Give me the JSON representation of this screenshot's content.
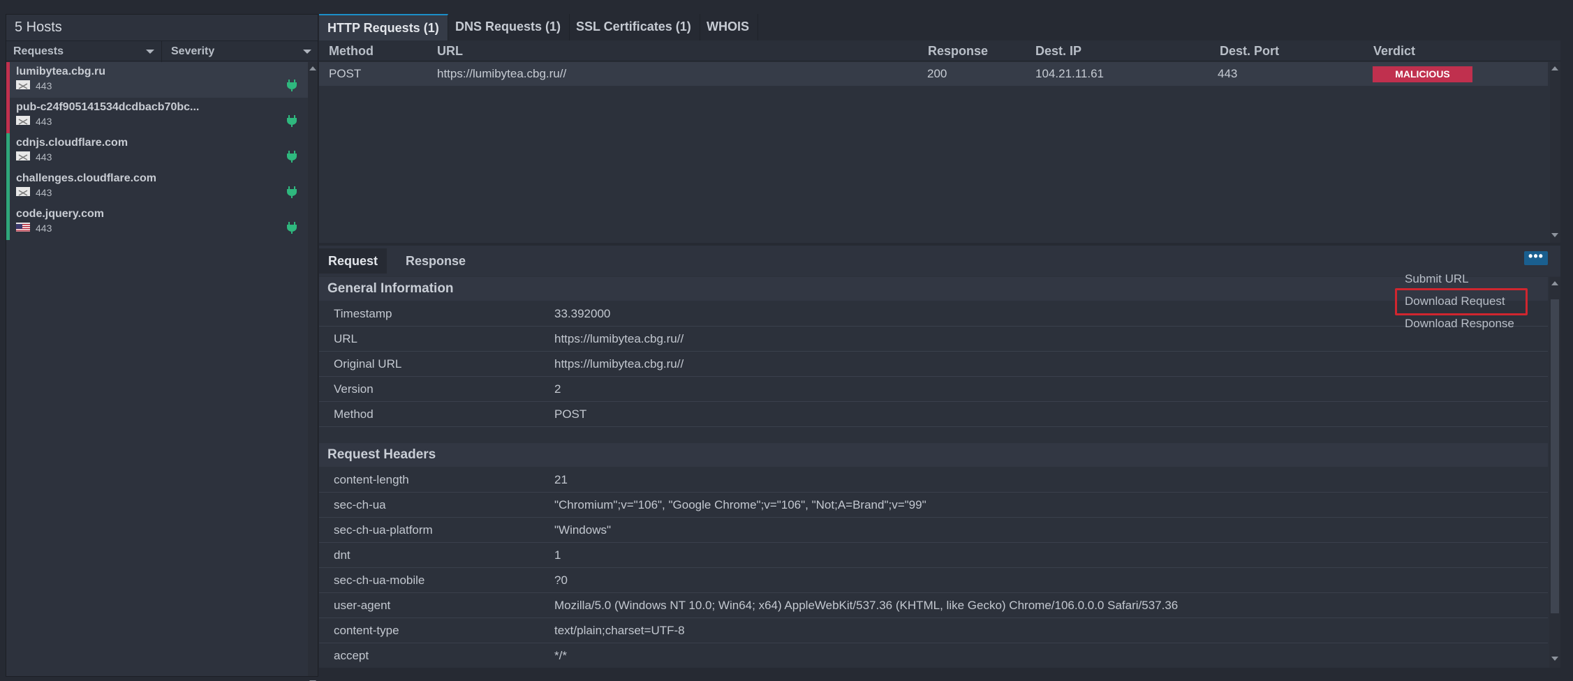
{
  "hosts": {
    "title": "5 Hosts",
    "col_requests": "Requests",
    "col_severity": "Severity",
    "items": [
      {
        "name": "lumibytea.cbg.ru",
        "port": "443",
        "severity_color": "#c0304e",
        "flag": "generic"
      },
      {
        "name": "pub-c24f905141534dcdbacb70bc...",
        "port": "443",
        "severity_color": "#c0304e",
        "flag": "generic"
      },
      {
        "name": "cdnjs.cloudflare.com",
        "port": "443",
        "severity_color": "#2fa57a",
        "flag": "generic"
      },
      {
        "name": "challenges.cloudflare.com",
        "port": "443",
        "severity_color": "#2fa57a",
        "flag": "generic"
      },
      {
        "name": "code.jquery.com",
        "port": "443",
        "severity_color": "#2fa57a",
        "flag": "us"
      }
    ],
    "plug_icon": "plug-icon",
    "plug_color": "#2fb87e"
  },
  "tabs": [
    {
      "label": "HTTP Requests (1)"
    },
    {
      "label": "DNS Requests (1)"
    },
    {
      "label": "SSL Certificates (1)"
    },
    {
      "label": "WHOIS"
    }
  ],
  "request_table": {
    "headers": {
      "method": "Method",
      "url": "URL",
      "response": "Response",
      "dest_ip": "Dest. IP",
      "dest_port": "Dest. Port",
      "verdict": "Verdict"
    },
    "rows": [
      {
        "method": "POST",
        "url": "https://lumibytea.cbg.ru//",
        "response": "200",
        "dest_ip": "104.21.11.61",
        "dest_port": "443",
        "verdict": "MALICIOUS"
      }
    ],
    "verdict_color": "#c0304e"
  },
  "detail": {
    "tabs": [
      {
        "label": "Request"
      },
      {
        "label": "Response"
      }
    ],
    "more_label": "•••",
    "general_title": "General Information",
    "general": [
      {
        "key": "Timestamp",
        "value": "33.392000"
      },
      {
        "key": "URL",
        "value": "https://lumibytea.cbg.ru//"
      },
      {
        "key": "Original URL",
        "value": "https://lumibytea.cbg.ru//"
      },
      {
        "key": "Version",
        "value": "2"
      },
      {
        "key": "Method",
        "value": "POST"
      }
    ],
    "headers_title": "Request Headers",
    "headers": [
      {
        "key": "content-length",
        "value": "21"
      },
      {
        "key": "sec-ch-ua",
        "value": "\"Chromium\";v=\"106\", \"Google Chrome\";v=\"106\", \"Not;A=Brand\";v=\"99\""
      },
      {
        "key": "sec-ch-ua-platform",
        "value": "\"Windows\""
      },
      {
        "key": "dnt",
        "value": "1"
      },
      {
        "key": "sec-ch-ua-mobile",
        "value": "?0"
      },
      {
        "key": "user-agent",
        "value": "Mozilla/5.0 (Windows NT 10.0; Win64; x64) AppleWebKit/537.36 (KHTML, like Gecko) Chrome/106.0.0.0 Safari/537.36"
      },
      {
        "key": "content-type",
        "value": "text/plain;charset=UTF-8"
      },
      {
        "key": "accept",
        "value": "*/*"
      }
    ]
  },
  "menu": {
    "items": [
      {
        "label": "Submit URL"
      },
      {
        "label": "Download Request"
      },
      {
        "label": "Download Response"
      }
    ],
    "highlight_color": "#d0262f"
  }
}
